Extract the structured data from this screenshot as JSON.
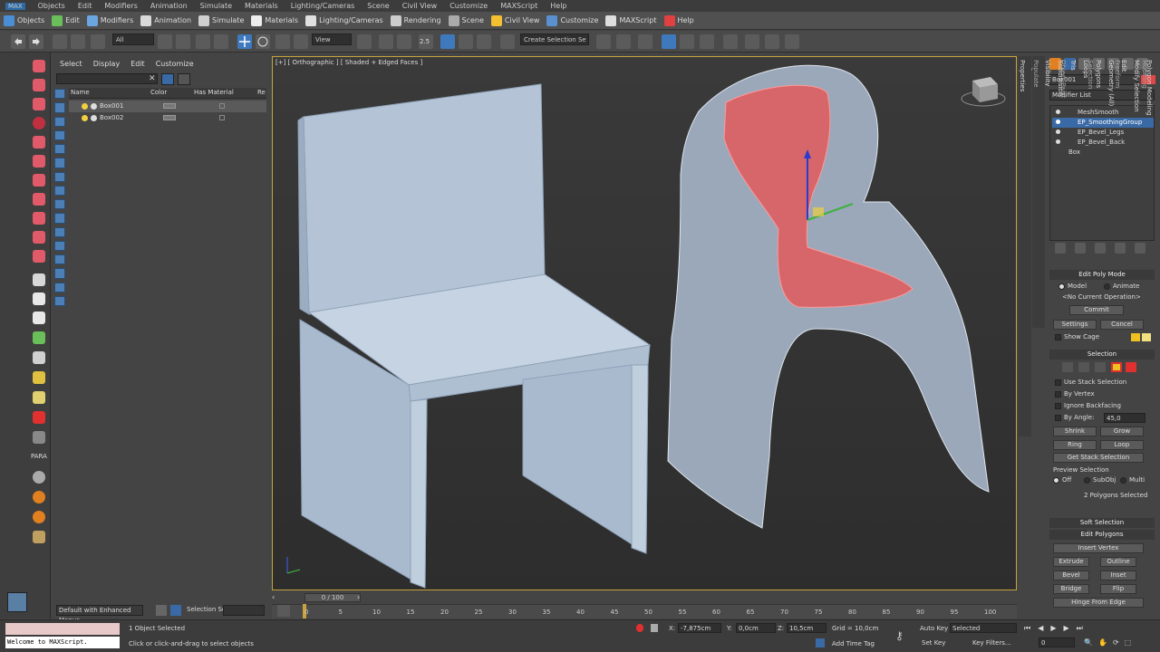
{
  "menubar": {
    "logo": "MAX",
    "items": [
      "Objects",
      "Edit",
      "Modifiers",
      "Animation",
      "Simulate",
      "Materials",
      "Lighting/Cameras",
      "Scene",
      "Civil View",
      "Customize",
      "MAXScript",
      "Help"
    ]
  },
  "ribbon": {
    "tabs": [
      {
        "label": "Objects",
        "color": "#4a8fd4"
      },
      {
        "label": "Edit",
        "color": "#6bbf5a"
      },
      {
        "label": "Modifiers",
        "color": "#6aa7e0"
      },
      {
        "label": "Animation",
        "color": "#d9d9d9"
      },
      {
        "label": "Simulate",
        "color": "#d0d0d0"
      },
      {
        "label": "Materials",
        "color": "#eeeeee"
      },
      {
        "label": "Lighting/Cameras",
        "color": "#e0e0e0"
      },
      {
        "label": "Rendering",
        "color": "#cccccc"
      },
      {
        "label": "Scene",
        "color": "#aaaaaa"
      },
      {
        "label": "Civil View",
        "color": "#f2c030"
      },
      {
        "label": "Customize",
        "color": "#5a90d0"
      },
      {
        "label": "MAXScript",
        "color": "#dddddd"
      },
      {
        "label": "Help",
        "color": "#e04040"
      }
    ]
  },
  "toolbar": {
    "filter": "All",
    "refcoord": "View",
    "selset": "Create Selection Se",
    "snap_label": "2.5"
  },
  "scene": {
    "menu": [
      "Select",
      "Display",
      "Edit",
      "Customize"
    ],
    "columns": [
      "Name",
      "Color",
      "Has Material",
      "Re"
    ],
    "rows": [
      {
        "name": "Box001",
        "selected": true
      },
      {
        "name": "Box002",
        "selected": false
      }
    ],
    "bottom_dropdown": "Default with Enhanced Menus",
    "selection_set_label": "Selection Set:"
  },
  "viewport": {
    "label": "[+] [ Orthographic ] [ Shaded + Edged Faces ]"
  },
  "timeline": {
    "slider": "0 / 100",
    "ticks": [
      "0",
      "5",
      "10",
      "15",
      "20",
      "25",
      "30",
      "35",
      "40",
      "45",
      "50",
      "55",
      "60",
      "65",
      "70",
      "75",
      "80",
      "85",
      "90",
      "95",
      "100"
    ]
  },
  "command_panel": {
    "object_name": "Box001",
    "object_color": "#e04848",
    "modifier_list": "Modifier List",
    "stack": [
      {
        "label": "MeshSmooth",
        "selected": false
      },
      {
        "label": "EP_SmoothingGroup",
        "selected": true
      },
      {
        "label": "EP_Bevel_Legs",
        "selected": false
      },
      {
        "label": "EP_Bevel_Back",
        "selected": false
      },
      {
        "label": "Box",
        "selected": false
      }
    ],
    "edit_poly_mode": {
      "title": "Edit Poly Mode",
      "model": "Model",
      "animate": "Animate",
      "current_op": "<No Current Operation>",
      "commit": "Commit",
      "settings": "Settings",
      "cancel": "Cancel",
      "show_cage": "Show Cage"
    },
    "selection": {
      "title": "Selection",
      "use_stack": "Use Stack Selection",
      "by_vertex": "By Vertex",
      "ignore_backfacing": "Ignore Backfacing",
      "by_angle": "By Angle:",
      "angle_value": "45,0",
      "shrink": "Shrink",
      "grow": "Grow",
      "ring": "Ring",
      "loop": "Loop",
      "get_stack": "Get Stack Selection",
      "preview": "Preview Selection",
      "off": "Off",
      "subobj": "SubObj",
      "multi": "Multi",
      "status": "2 Polygons Selected"
    },
    "soft_selection": "Soft Selection",
    "edit_polygons": "Edit Polygons",
    "insert_vertex": "Insert Vertex",
    "extrude": "Extrude",
    "outline": "Outline",
    "bevel": "Bevel",
    "inset": "Inset",
    "bridge": "Bridge",
    "flip": "Flip",
    "hinge": "Hinge From Edge"
  },
  "side_tabs_left": [
    "Polygon Modeling",
    "Modify Selection",
    "Edit",
    "Geometry (All)",
    "Polygons",
    "Loops",
    "Tris",
    "Subdivision",
    "Visibility",
    "Align",
    "Properties"
  ],
  "side_tabs_right": [
    "Modeling",
    "Freeform",
    "Selection",
    "Object Paint",
    "Populate"
  ],
  "status": {
    "objects_selected": "1 Object Selected",
    "hint": "Click or click-and-drag to select objects",
    "x": "-7,875cm",
    "y": "0,0cm",
    "z": "10,5cm",
    "grid": "Grid = 10,0cm",
    "auto_key": "Auto Key",
    "auto_mode": "Selected",
    "set_key": "Set Key",
    "key_filters": "Key Filters...",
    "add_time_tag": "Add Time Tag",
    "frame": "0",
    "maxscript": "Welcome to MAXScript.",
    "para": "PARA"
  }
}
